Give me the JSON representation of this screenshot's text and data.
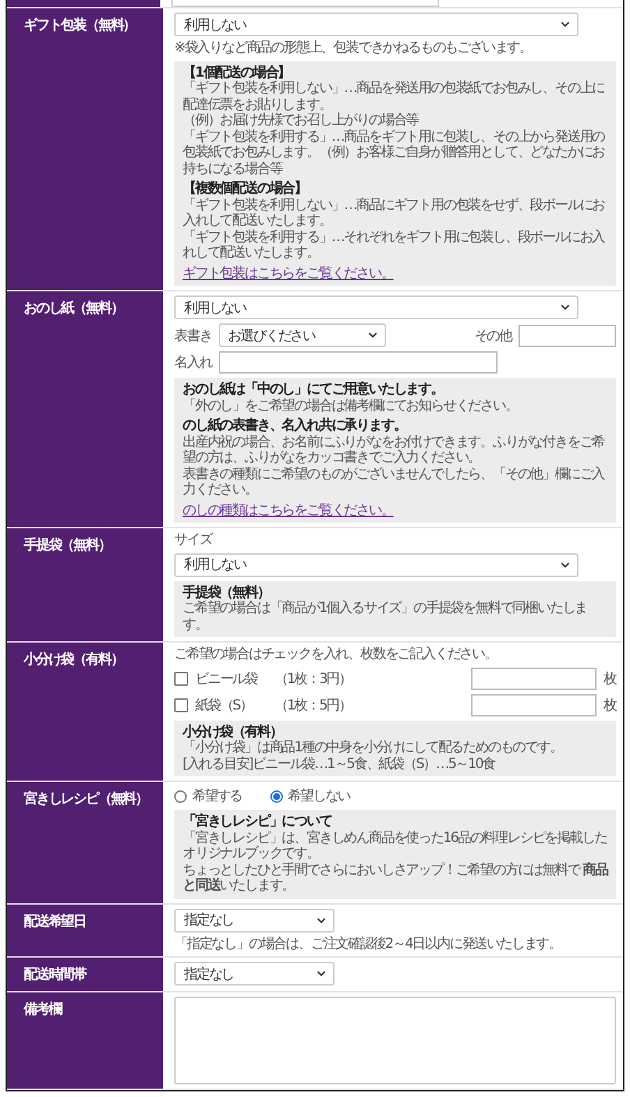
{
  "sections": [
    {
      "label": "ギフト包装（無料）",
      "controls": [
        {
          "kind": "select",
          "value": "利用しない"
        },
        {
          "kind": "note",
          "text": "※袋入りなど商品の形態上、包装できかねるものもございます。"
        },
        {
          "kind": "info",
          "blocks": [
            {
              "title": "【1個配送の場合】",
              "lines": [
                "「ギフト包装を利用しない」…商品を発送用の包装紙でお包みし、その上に配達伝票をお貼りします。",
                "（例）お届け先様でお召し上がりの場合等",
                "「ギフト包装を利用する」…商品をギフト用に包装し、その上から発送用の包装紙でお包みします。（例）お客様ご自身が贈答用として、どなたかにお持ちになる場合等"
              ]
            },
            {
              "title": "【複数個配送の場合】",
              "lines": [
                "「ギフト包装を利用しない」…商品にギフト用の包装をせず、段ボールにお入れして配送いたします。",
                "「ギフト包装を利用する」…それぞれをギフト用に包装し、段ボールにお入れして配送いたします。"
              ]
            }
          ],
          "link": "ギフト包装はこちらをご覧ください。"
        }
      ]
    },
    {
      "label": "おのし紙（無料）",
      "controls": [
        {
          "kind": "select",
          "value": "利用しない"
        },
        {
          "kind": "noshi",
          "omote_label": "表書き",
          "omote_value": "お選びください",
          "other_label": "その他",
          "name_label": "名入れ"
        },
        {
          "kind": "info",
          "blocks": [
            {
              "title": "おのし紙は「中のし」にてご用意いたします。",
              "lines": [
                "「外のし」をご希望の場合は備考欄にてお知らせください。"
              ]
            },
            {
              "title": "のし紙の表書き、名入れ共に承ります。",
              "lines": [
                "出産内祝の場合、お名前にふりがなをお付けできます。ふりがな付きをご希望の方は、ふりがなをカッコ書きでご入力ください。",
                "表書きの種類にご希望のものがございませんでしたら、「その他」欄にご入力ください。"
              ]
            }
          ],
          "link": "のしの種類はこちらをご覧ください。"
        }
      ]
    },
    {
      "label": "手提袋（無料）",
      "controls": [
        {
          "kind": "note",
          "text": "サイズ"
        },
        {
          "kind": "select",
          "value": "利用しない"
        },
        {
          "kind": "info",
          "blocks": [
            {
              "title": "手提袋（無料）",
              "lines": [
                "ご希望の場合は「商品が1個入るサイズ」の手提袋を無料で同梱いたします。"
              ]
            }
          ]
        }
      ]
    },
    {
      "label": "小分け袋（有料）",
      "controls": [
        {
          "kind": "note",
          "text": "ご希望の場合はチェックを入れ、枚数をご記入ください。"
        },
        {
          "kind": "checks",
          "items": [
            {
              "label": "ビニール袋",
              "price": "（1枚：3円）",
              "checked": false,
              "unit": "枚"
            },
            {
              "label": "紙袋（S）",
              "price": "（1枚：5円）",
              "checked": false,
              "unit": "枚"
            }
          ]
        },
        {
          "kind": "info",
          "blocks": [
            {
              "title": "小分け袋（有料）",
              "lines": [
                "「小分け袋」は商品1種の中身を小分けにして配るためのものです。",
                "[入れる目安]ビニール袋…1～5食、紙袋（S）…5～10食"
              ]
            }
          ]
        }
      ]
    },
    {
      "label": "宮きしレシピ（無料）",
      "controls": [
        {
          "kind": "radios",
          "options": [
            {
              "label": "希望する",
              "selected": false
            },
            {
              "label": "希望しない",
              "selected": true
            }
          ]
        },
        {
          "kind": "info",
          "blocks": [
            {
              "title": "「宮きしレシピ」について",
              "lines": [
                "「宮きしレシピ」は、宮きしめん商品を使った16品の料理レシピを掲載したオリジナルブックです。",
                "ちょっとしたひと手間でさらにおいしさアップ！ご希望の方には無料で **商品と同送**いたします。"
              ]
            }
          ]
        }
      ]
    },
    {
      "label": "配送希望日",
      "controls": [
        {
          "kind": "compact_select",
          "value": "指定なし"
        },
        {
          "kind": "note",
          "text": "「指定なし」の場合は、ご注文確認後2～4日以内に発送いたします。"
        }
      ]
    },
    {
      "label": "配送時間帯",
      "controls": [
        {
          "kind": "compact_select",
          "value": "指定なし"
        }
      ]
    },
    {
      "label": "備考欄",
      "controls": [
        {
          "kind": "textarea"
        }
      ]
    }
  ]
}
